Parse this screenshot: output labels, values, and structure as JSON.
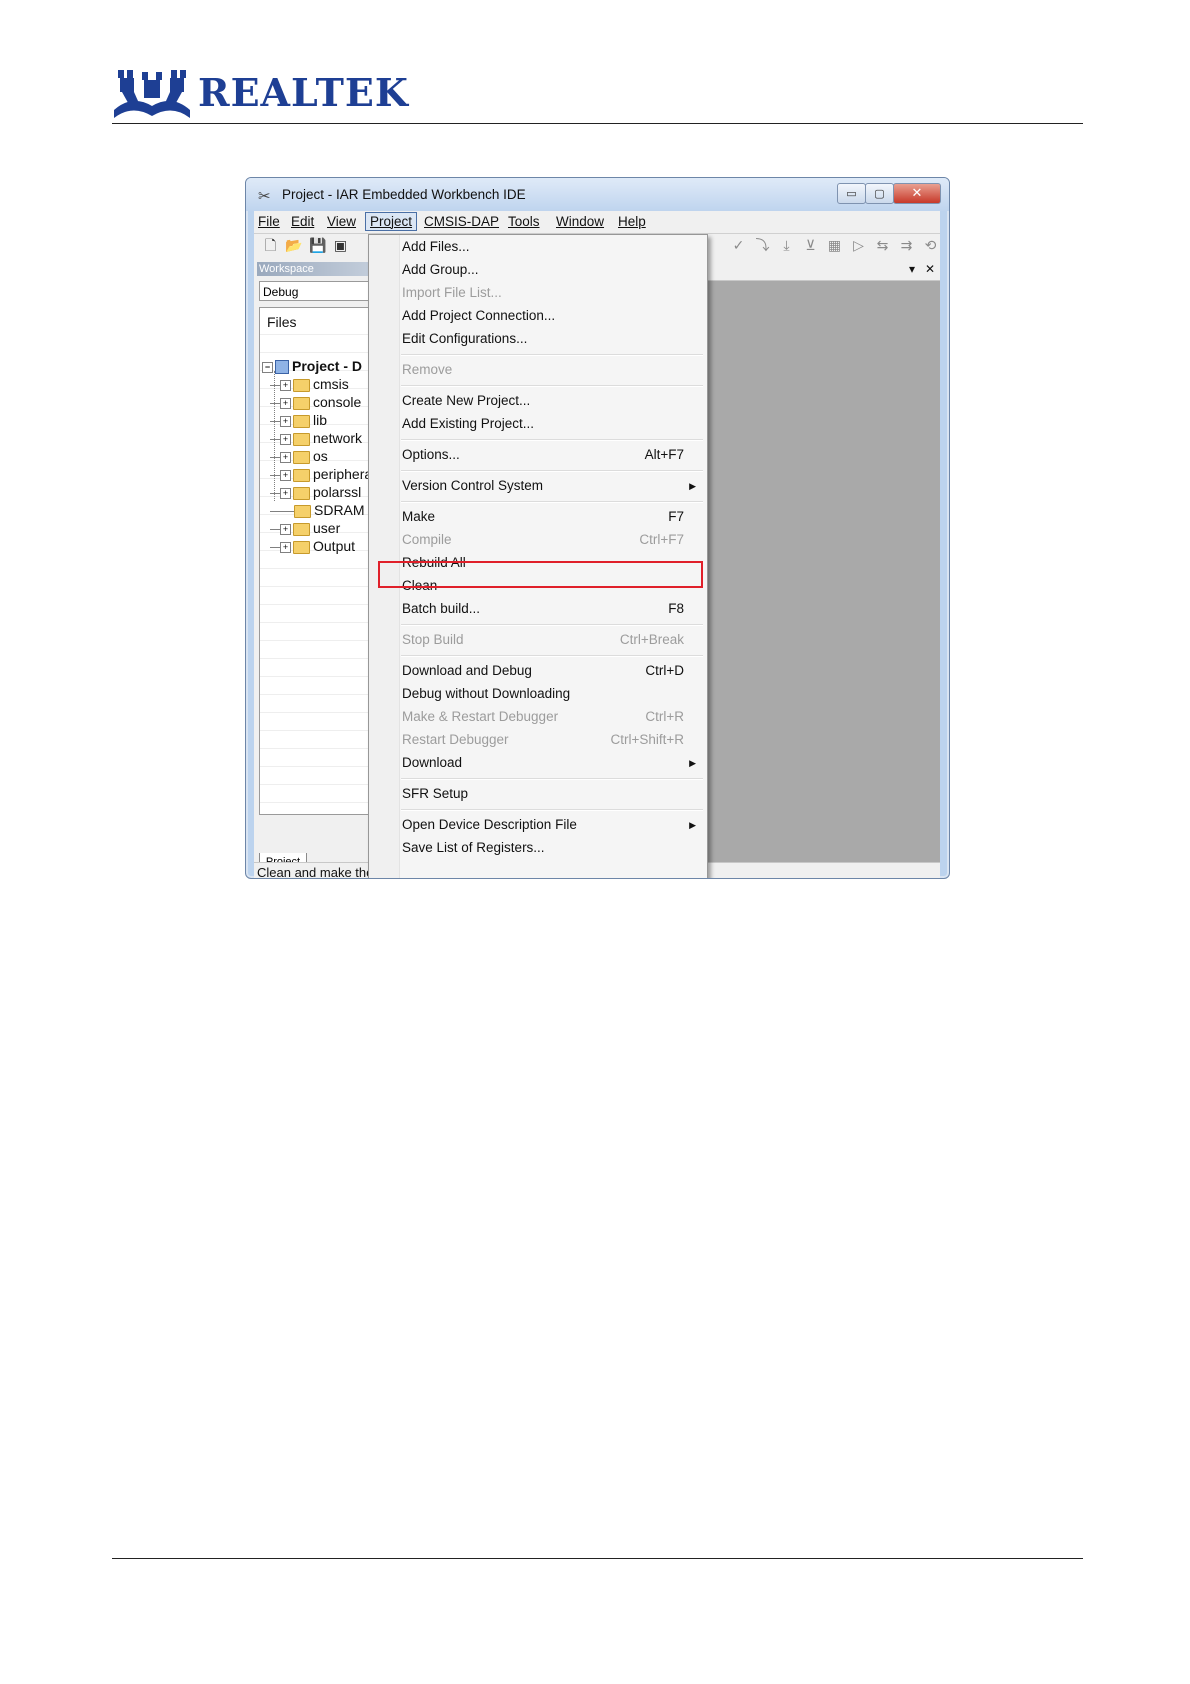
{
  "header": {
    "brand": "REALTEK"
  },
  "window": {
    "title": "Project - IAR Embedded Workbench IDE",
    "buttons": {
      "minimize": "▭",
      "maximize": "▢",
      "close": "✕"
    }
  },
  "menubar": [
    "File",
    "Edit",
    "View",
    "Project",
    "CMSIS-DAP",
    "Tools",
    "Window",
    "Help"
  ],
  "workspace": {
    "label": "Workspace",
    "config": "Debug",
    "files_header": "Files",
    "project_node": "Project - D",
    "tree": [
      "cmsis",
      "console",
      "lib",
      "network",
      "os",
      "peripheral",
      "polarssl",
      "SDRAM",
      "user",
      "Output"
    ],
    "tab": "Project"
  },
  "status": "Clean and make the",
  "dropdown": {
    "items": [
      {
        "label": "Add Files...",
        "shortcut": "",
        "disabled": false
      },
      {
        "label": "Add Group...",
        "shortcut": "",
        "disabled": false
      },
      {
        "label": "Import File List...",
        "shortcut": "",
        "disabled": true
      },
      {
        "label": "Add Project Connection...",
        "shortcut": "",
        "disabled": false
      },
      {
        "label": "Edit Configurations...",
        "shortcut": "",
        "disabled": false
      },
      {
        "label": "Remove",
        "shortcut": "",
        "disabled": true
      },
      {
        "label": "Create New Project...",
        "shortcut": "",
        "disabled": false
      },
      {
        "label": "Add Existing Project...",
        "shortcut": "",
        "disabled": false
      },
      {
        "label": "Options...",
        "shortcut": "Alt+F7",
        "disabled": false
      },
      {
        "label": "Version Control System",
        "shortcut": "",
        "disabled": false,
        "submenu": true
      },
      {
        "label": "Make",
        "shortcut": "F7",
        "disabled": false
      },
      {
        "label": "Compile",
        "shortcut": "Ctrl+F7",
        "disabled": true
      },
      {
        "label": "Rebuild All",
        "shortcut": "",
        "disabled": false
      },
      {
        "label": "Clean",
        "shortcut": "",
        "disabled": false
      },
      {
        "label": "Batch build...",
        "shortcut": "F8",
        "disabled": false
      },
      {
        "label": "Stop Build",
        "shortcut": "Ctrl+Break",
        "disabled": true
      },
      {
        "label": "Download and Debug",
        "shortcut": "Ctrl+D",
        "disabled": false
      },
      {
        "label": "Debug without Downloading",
        "shortcut": "",
        "disabled": false
      },
      {
        "label": "Make & Restart Debugger",
        "shortcut": "Ctrl+R",
        "disabled": true
      },
      {
        "label": "Restart Debugger",
        "shortcut": "Ctrl+Shift+R",
        "disabled": true
      },
      {
        "label": "Download",
        "shortcut": "",
        "disabled": false,
        "submenu": true
      },
      {
        "label": "SFR Setup",
        "shortcut": "",
        "disabled": false
      },
      {
        "label": "Open Device Description File",
        "shortcut": "",
        "disabled": false,
        "submenu": true
      },
      {
        "label": "Save List of Registers...",
        "shortcut": "",
        "disabled": false
      }
    ]
  },
  "colors": {
    "brand": "#1e3f94",
    "highlight": "#e0202a"
  }
}
